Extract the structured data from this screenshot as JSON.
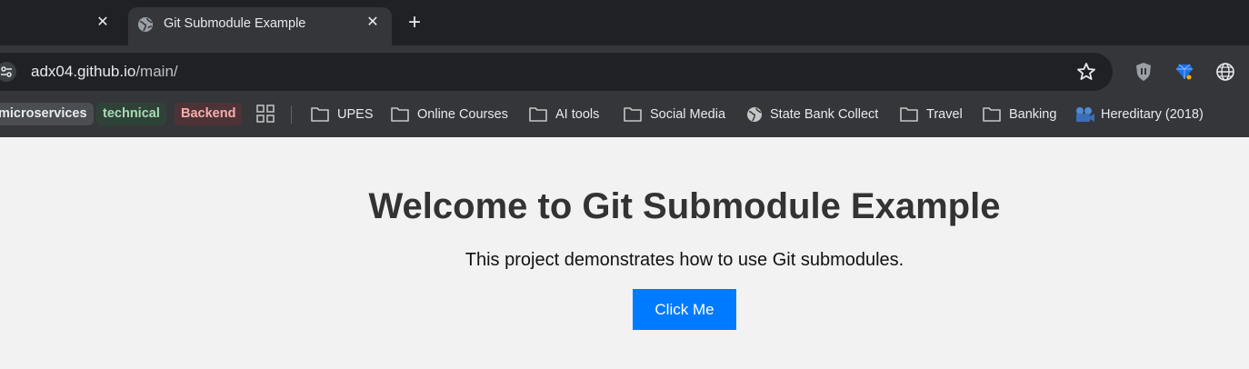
{
  "browser": {
    "tabs": [
      {
        "title": "",
        "active": false
      },
      {
        "title": "Git Submodule Example",
        "active": true,
        "favicon": "globe-icon"
      }
    ],
    "close_glyph": "✕",
    "new_tab_glyph": "+",
    "url_host": "adx04.github.io",
    "url_path": "/main/",
    "extensions": [
      "shield-extension-icon",
      "gem-extension-icon",
      "globe-extension-icon"
    ]
  },
  "bookmarks": {
    "groups": [
      {
        "label": "microservices",
        "color": "#9aa0a6"
      },
      {
        "label": "technical",
        "color": "#81c995"
      },
      {
        "label": "Backend",
        "color": "#f28b82"
      }
    ],
    "items": [
      {
        "label": "UPES",
        "icon": "folder-icon"
      },
      {
        "label": "Online Courses",
        "icon": "folder-icon"
      },
      {
        "label": "AI tools",
        "icon": "folder-icon"
      },
      {
        "label": "Social Media",
        "icon": "folder-icon"
      },
      {
        "label": "State Bank Collect",
        "icon": "globe-icon"
      },
      {
        "label": "Travel",
        "icon": "folder-icon"
      },
      {
        "label": "Banking",
        "icon": "folder-icon"
      },
      {
        "label": "Hereditary (2018)",
        "icon": "film-icon"
      }
    ]
  },
  "page": {
    "heading": "Welcome to Git Submodule Example",
    "description": "This project demonstrates how to use Git submodules.",
    "button_label": "Click Me",
    "button_color": "#007bff",
    "background": "#f2f2f2"
  }
}
